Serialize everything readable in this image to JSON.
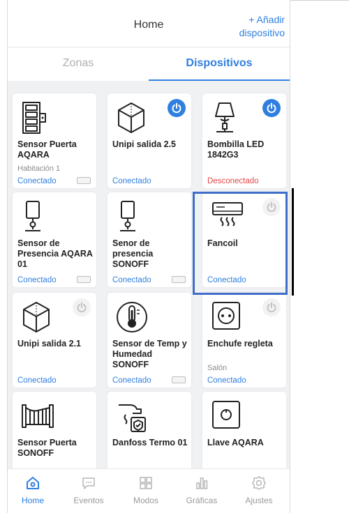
{
  "header": {
    "title": "Home",
    "add_line1": "+ Añadir",
    "add_line2": "dispositivo"
  },
  "tabs": [
    {
      "label": "Zonas",
      "active": false
    },
    {
      "label": "Dispositivos",
      "active": true
    }
  ],
  "devices": [
    {
      "name": "Sensor Puerta AQARA",
      "zone": "Habitación 1",
      "status": "Conectado",
      "icon": "door-sensor-icon",
      "power": "none"
    },
    {
      "name": "Unipi salida 2.5",
      "zone": "",
      "status": "Conectado",
      "icon": "cube-icon",
      "power": "on"
    },
    {
      "name": "Bombilla LED 1842G3",
      "zone": "",
      "status": "Desconectado",
      "icon": "lamp-icon",
      "power": "on"
    },
    {
      "name": "Sensor de Presencia AQARA 01",
      "zone": "",
      "status": "Conectado",
      "icon": "presence-sensor-icon",
      "power": "none"
    },
    {
      "name": "Senor de presencia SONOFF",
      "zone": "",
      "status": "Conectado",
      "icon": "presence-sensor-icon",
      "power": "none"
    },
    {
      "name": "Fancoil",
      "zone": "",
      "status": "Conectado",
      "icon": "air-conditioner-icon",
      "power": "off"
    },
    {
      "name": "Unipi salida 2.1",
      "zone": "",
      "status": "Conectado",
      "icon": "cube-icon",
      "power": "off"
    },
    {
      "name": "Sensor de Temp y Humedad SONOFF",
      "zone": "",
      "status": "Conectado",
      "icon": "thermometer-icon",
      "power": "none"
    },
    {
      "name": "Enchufe regleta",
      "zone": "Salón",
      "status": "Conectado",
      "icon": "socket-icon",
      "power": "off"
    },
    {
      "name": "Sensor Puerta SONOFF",
      "zone": "",
      "status": "",
      "icon": "gate-icon",
      "power": "none"
    },
    {
      "name": "Danfoss Termo 01",
      "zone": "",
      "status": "",
      "icon": "thermostat-hand-icon",
      "power": "none"
    },
    {
      "name": "Llave AQARA",
      "zone": "",
      "status": "",
      "icon": "switch-icon",
      "power": "none"
    }
  ],
  "nav": [
    {
      "label": "Home",
      "icon": "home-icon",
      "active": true
    },
    {
      "label": "Eventos",
      "icon": "chat-icon",
      "active": false
    },
    {
      "label": "Modos",
      "icon": "grid-icon",
      "active": false
    },
    {
      "label": "Gráficas",
      "icon": "bar-chart-icon",
      "active": false
    },
    {
      "label": "Ajustes",
      "icon": "gear-icon",
      "active": false
    }
  ],
  "colors": {
    "accent": "#2f7fe0",
    "error": "#e04848",
    "selection": "#3f6dc9"
  }
}
